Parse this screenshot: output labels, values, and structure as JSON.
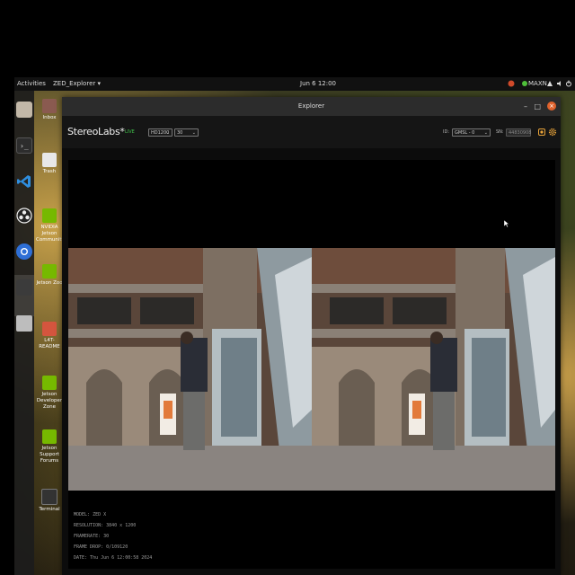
{
  "topbar": {
    "activities": "Activities",
    "app_menu": "ZED_Explorer ▾",
    "clock": "Jun 6 12:00",
    "power_mode": "MAXN"
  },
  "desktop": {
    "items": [
      {
        "label": "Inbox"
      },
      {
        "label": "Trash"
      },
      {
        "label": "NVIDIA Jetson Community"
      },
      {
        "label": "Jetson Zoo"
      },
      {
        "label": "L4T-README"
      },
      {
        "label": "Jetson Developer Zone"
      },
      {
        "label": "Jetson Support Forums"
      },
      {
        "label": "Terminal"
      }
    ]
  },
  "window": {
    "title": "Explorer",
    "minimize": "–",
    "maximize": "□",
    "close": "×"
  },
  "app": {
    "logo": "StereoLabs*",
    "status": "LIVE",
    "resolution": "HD1200",
    "fps": "30",
    "id_label": "ID:",
    "device": "GMSL - 0",
    "sn_label": "SN:",
    "serial": "44830908"
  },
  "info": {
    "model": "MODEL: ZED X",
    "resolution": "RESOLUTION: 3840 x 1200",
    "framerate": "FRAMERATE: 30",
    "frame_drop": "FRAME DROP: 0/109120",
    "date": "DATE: Thu Jun 6 12:00:58 2024"
  },
  "colors": {
    "accent": "#e0622c",
    "live": "#3fc14a",
    "panel": "#151515"
  }
}
